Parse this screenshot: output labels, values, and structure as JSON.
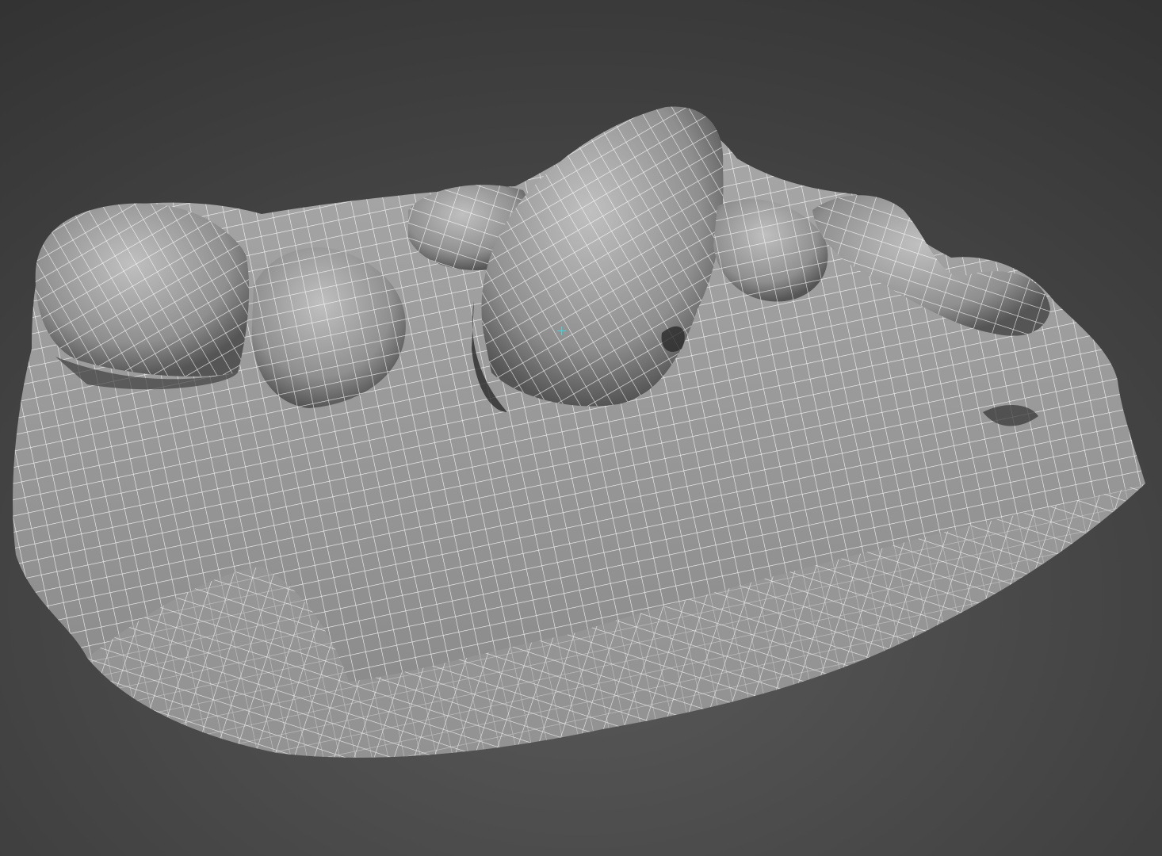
{
  "viewport": {
    "background_top": "#3a3a3a",
    "background_bottom": "#535353",
    "mesh_shade_light": "#b4b4b4",
    "mesh_shade_mid": "#8c8c8c",
    "mesh_shade_dark": "#4a4a4a",
    "wireframe_color": "#ffffff",
    "cursor_color": "#3ad9e0"
  },
  "scene": {
    "object": "rock-terrain-mesh",
    "display_mode": "shaded-with-wireframe",
    "cursor": "crosshair-cursor-icon"
  }
}
